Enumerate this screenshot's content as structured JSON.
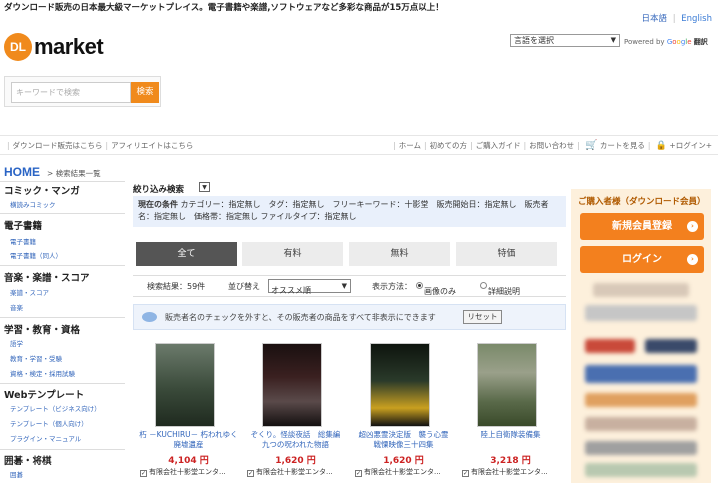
{
  "header": {
    "tagline": "ダウンロード販売の日本最大級マーケットプレイス。電子書籍や楽譜,ソフトウェアなど多彩な商品が15万点以上！",
    "lang_ja": "日本語",
    "lang_en": "English",
    "logo_mark": "DL",
    "logo_text": "market",
    "lang_select": "言語を選択",
    "powered_by": "Powered by",
    "google": [
      "G",
      "o",
      "o",
      "g",
      "l",
      "e"
    ],
    "translate": "翻訳"
  },
  "search": {
    "placeholder": "キーワードで検索",
    "button": "検索"
  },
  "navlinks": {
    "left": [
      "ダウンロード販売はこちら",
      "アフィリエイトはこちら"
    ],
    "right": [
      "ホーム",
      "初めての方",
      "ご購入ガイド",
      "お問い合わせ",
      "カートを見る",
      "+ログイン+"
    ]
  },
  "breadcrumb": {
    "home": "HOME",
    "current": "> 検索結果一覧"
  },
  "sidebar": {
    "cats": [
      {
        "label": "コミック・マンガ",
        "subs": [
          "横読みコミック"
        ]
      },
      {
        "label": "電子書籍",
        "subs": [
          "電子書籍",
          "電子書籍（同人）"
        ]
      },
      {
        "label": "音楽・楽譜・スコア",
        "subs": [
          "楽譜・スコア",
          "音楽"
        ]
      },
      {
        "label": "学習・教育・資格",
        "subs": [
          "語学",
          "教育・学習・受験",
          "資格・検定・採用試験"
        ]
      },
      {
        "label": "Webテンプレート",
        "subs": [
          "テンプレート（ビジネス向け）",
          "テンプレート（個人向け）",
          "プラグイン・マニュアル"
        ]
      },
      {
        "label": "囲碁・将棋",
        "subs": [
          "囲碁"
        ]
      }
    ]
  },
  "filter": {
    "title": "絞り込み検索",
    "toggle": "▼",
    "cond_label": "現在の条件",
    "cond_text": "カテゴリー：指定無し　タグ：指定無し　フリーキーワード：十影堂　販売開始日：指定無し　販売者名：指定無し　価格帯：指定無し ファイルタイプ：指定無し"
  },
  "tabs": [
    "全て",
    "有料",
    "無料",
    "特価"
  ],
  "results": {
    "count": "検索結果：59件",
    "sort_label": "並び替え",
    "sort_value": "オススメ順",
    "display_label": "表示方法：",
    "opt_image": "画像のみ",
    "opt_detail": "詳細説明"
  },
  "notice": {
    "text": "販売者名のチェックを外すと、その販売者の商品をすべて非表示にできます",
    "reset": "リセット"
  },
  "products": [
    {
      "title": "朽 －KUCHIRU－ 朽われゆく廃墟遺産",
      "price": "4,104 円",
      "seller": "有限会社十影堂エンタ...",
      "cover_color": "#4a5a4a"
    },
    {
      "title": "ぞくり。怪談夜話　総集編　九つの呪われた物語",
      "price": "1,620 円",
      "seller": "有限会社十影堂エンタ...",
      "cover_color": "#2a1a1a"
    },
    {
      "title": "超凶悪霊決定版　襲う心霊　戦慄映像三十四集",
      "price": "1,620 円",
      "seller": "有限会社十影堂エンタ...",
      "cover_color": "#1e2a1e"
    },
    {
      "title": "陸上自衛隊装備集",
      "price": "3,218 円",
      "seller": "有限会社十影堂エンタ...",
      "cover_color": "#6a7a5a"
    }
  ],
  "right_panel": {
    "heading": "ご購入者様（ダウンロード会員）",
    "register": "新規会員登録",
    "login": "ログイン"
  },
  "colors": {
    "accent": "#f08a1c",
    "link": "#3366bb",
    "price": "#cc2222",
    "tab_active": "#555555"
  }
}
